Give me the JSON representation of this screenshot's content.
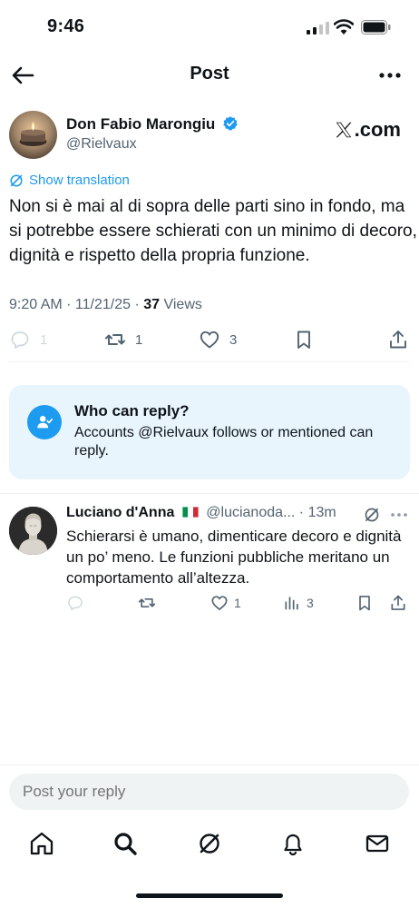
{
  "status_bar": {
    "time": "9:46"
  },
  "header": {
    "title": "Post"
  },
  "post": {
    "author_name": "Don Fabio Marongiu",
    "author_handle": "@Rielvaux",
    "badge_text": ".com",
    "show_translation": "Show translation",
    "text": "Non si è mai al di sopra delle parti sino in fondo, ma si potrebbe essere schierati con un minimo di decoro, dignità e rispetto della propria funzione.",
    "timestamp": "9:20 AM · 11/21/25 · ",
    "views_count": "37",
    "views_label": " Views",
    "replies": "1",
    "reposts": "1",
    "likes": "3"
  },
  "who_can_reply": {
    "title": "Who can reply?",
    "description": "Accounts @Rielvaux follows or mentioned can reply."
  },
  "reply": {
    "name": "Luciano d'Anna",
    "handle": "@lucianoda...",
    "time": "· 13m",
    "text": "Schierarsi è umano, dimenticare decoro e dignità un po’ meno. Le funzioni pubbliche meritano un comportamento all’altezza.",
    "likes": "1",
    "views": "3"
  },
  "composer": {
    "placeholder": "Post your reply"
  },
  "icons": {
    "back": "arrow-left-icon",
    "more": "more-horizontal-icon",
    "verified": "verified-badge-icon",
    "grok": "grok-icon",
    "reply": "reply-icon",
    "repost": "repost-icon",
    "like": "heart-icon",
    "bookmark": "bookmark-icon",
    "share": "share-icon",
    "views": "views-icon",
    "home": "home-icon",
    "search": "search-icon",
    "notifications": "bell-icon",
    "messages": "mail-icon"
  },
  "colors": {
    "accent": "#1d9bf0",
    "text": "#0f1419",
    "muted": "#536471",
    "card_bg": "#e8f5fd"
  }
}
